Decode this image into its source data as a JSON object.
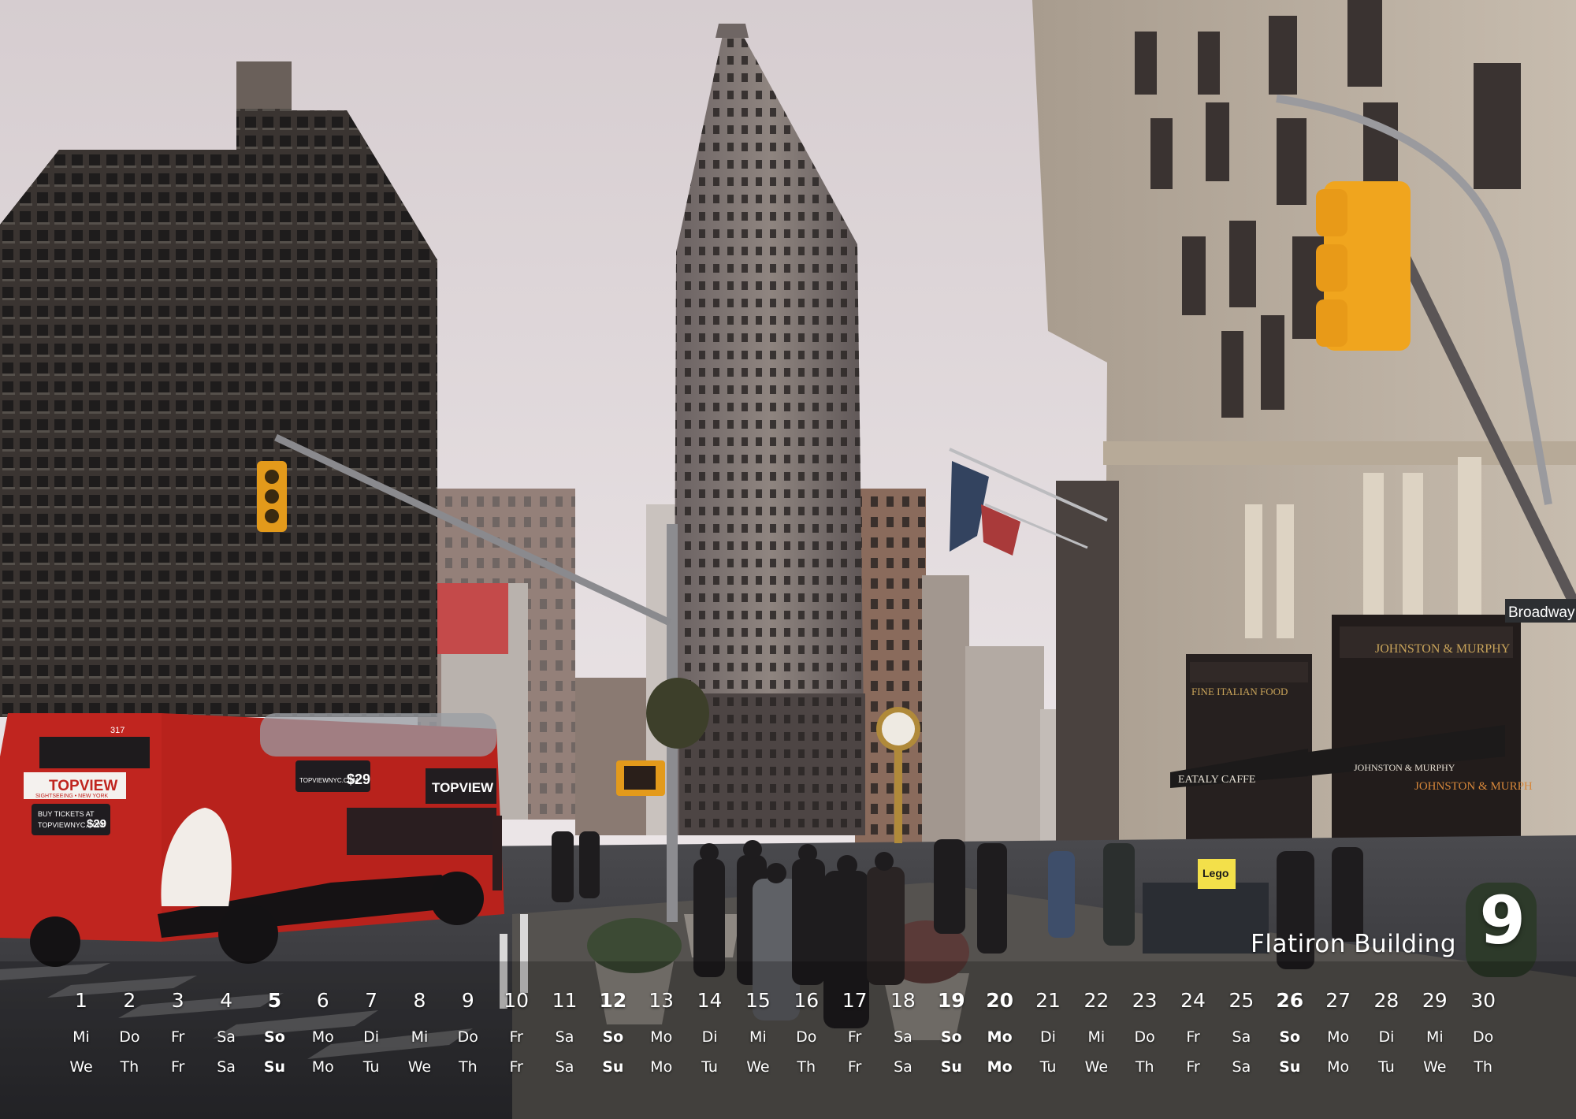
{
  "photo": {
    "subject": "street-scene-flatiron-building"
  },
  "bus": {
    "logo": "TOPVIEW",
    "logo_sub": "SIGHTSEEING • NEW YORK",
    "ad_line": "BUY TICKETS AT",
    "ad_site": "TOPVIEWNYC.COM",
    "price": "$29",
    "number": "317"
  },
  "signs": {
    "street": "Broadway",
    "cafe": "EATALY CAFFE",
    "food": "FINE ITALIAN FOOD",
    "store": "JOHNSTON & MURPHY",
    "store_awning": "JOHNSTON & MURPHY",
    "store_window": "JOHNSTON & MURPH",
    "lego": "Lego"
  },
  "calendar": {
    "title": "Flatiron Building",
    "month_number": "9",
    "days": [
      {
        "n": "1",
        "de": "Mi",
        "en": "We"
      },
      {
        "n": "2",
        "de": "Do",
        "en": "Th"
      },
      {
        "n": "3",
        "de": "Fr",
        "en": "Fr"
      },
      {
        "n": "4",
        "de": "Sa",
        "en": "Sa"
      },
      {
        "n": "5",
        "de": "So",
        "en": "Su",
        "hl": true
      },
      {
        "n": "6",
        "de": "Mo",
        "en": "Mo"
      },
      {
        "n": "7",
        "de": "Di",
        "en": "Tu"
      },
      {
        "n": "8",
        "de": "Mi",
        "en": "We"
      },
      {
        "n": "9",
        "de": "Do",
        "en": "Th"
      },
      {
        "n": "10",
        "de": "Fr",
        "en": "Fr"
      },
      {
        "n": "11",
        "de": "Sa",
        "en": "Sa"
      },
      {
        "n": "12",
        "de": "So",
        "en": "Su",
        "hl": true
      },
      {
        "n": "13",
        "de": "Mo",
        "en": "Mo"
      },
      {
        "n": "14",
        "de": "Di",
        "en": "Tu"
      },
      {
        "n": "15",
        "de": "Mi",
        "en": "We"
      },
      {
        "n": "16",
        "de": "Do",
        "en": "Th"
      },
      {
        "n": "17",
        "de": "Fr",
        "en": "Fr"
      },
      {
        "n": "18",
        "de": "Sa",
        "en": "Sa"
      },
      {
        "n": "19",
        "de": "So",
        "en": "Su",
        "hl": true
      },
      {
        "n": "20",
        "de": "Mo",
        "en": "Mo",
        "hl": true
      },
      {
        "n": "21",
        "de": "Di",
        "en": "Tu"
      },
      {
        "n": "22",
        "de": "Mi",
        "en": "We"
      },
      {
        "n": "23",
        "de": "Do",
        "en": "Th"
      },
      {
        "n": "24",
        "de": "Fr",
        "en": "Fr"
      },
      {
        "n": "25",
        "de": "Sa",
        "en": "Sa"
      },
      {
        "n": "26",
        "de": "So",
        "en": "Su",
        "hl": true
      },
      {
        "n": "27",
        "de": "Mo",
        "en": "Mo"
      },
      {
        "n": "28",
        "de": "Di",
        "en": "Tu"
      },
      {
        "n": "29",
        "de": "Mi",
        "en": "We"
      },
      {
        "n": "30",
        "de": "Do",
        "en": "Th"
      }
    ]
  }
}
